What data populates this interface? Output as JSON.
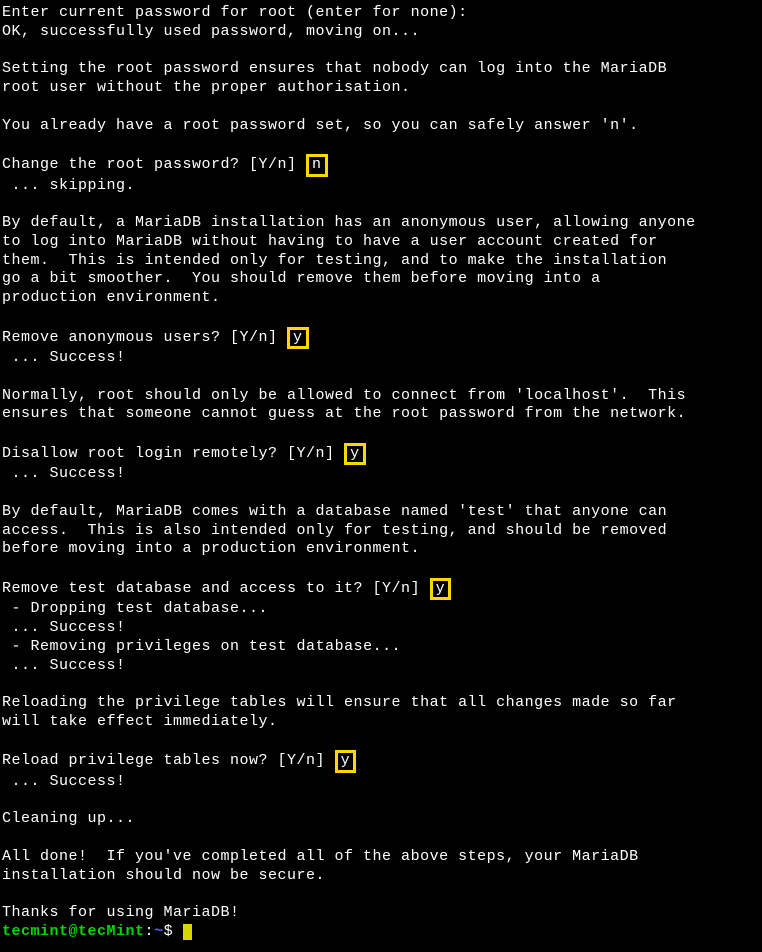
{
  "lines": {
    "l1": "Enter current password for root (enter for none):",
    "l2": "OK, successfully used password, moving on...",
    "l3": "Setting the root password ensures that nobody can log into the MariaDB",
    "l4": "root user without the proper authorisation.",
    "l5": "You already have a root password set, so you can safely answer 'n'.",
    "l6": "Change the root password? [Y/n] ",
    "l6h": "n",
    "l7": " ... skipping.",
    "l8": "By default, a MariaDB installation has an anonymous user, allowing anyone",
    "l9": "to log into MariaDB without having to have a user account created for",
    "l10": "them.  This is intended only for testing, and to make the installation",
    "l11": "go a bit smoother.  You should remove them before moving into a",
    "l12": "production environment.",
    "l13": "Remove anonymous users? [Y/n] ",
    "l13h": "y",
    "l14": " ... Success!",
    "l15": "Normally, root should only be allowed to connect from 'localhost'.  This",
    "l16": "ensures that someone cannot guess at the root password from the network.",
    "l17": "Disallow root login remotely? [Y/n] ",
    "l17h": "y",
    "l18": " ... Success!",
    "l19": "By default, MariaDB comes with a database named 'test' that anyone can",
    "l20": "access.  This is also intended only for testing, and should be removed",
    "l21": "before moving into a production environment.",
    "l22": "Remove test database and access to it? [Y/n] ",
    "l22h": "y",
    "l23": " - Dropping test database...",
    "l24": " ... Success!",
    "l25": " - Removing privileges on test database...",
    "l26": " ... Success!",
    "l27": "Reloading the privilege tables will ensure that all changes made so far",
    "l28": "will take effect immediately.",
    "l29": "Reload privilege tables now? [Y/n] ",
    "l29h": "y",
    "l30": " ... Success!",
    "l31": "Cleaning up...",
    "l32": "All done!  If you've completed all of the above steps, your MariaDB",
    "l33": "installation should now be secure.",
    "l34": "Thanks for using MariaDB!"
  },
  "prompt": {
    "user": "tecmint",
    "at": "@",
    "host": "tecMint",
    "colon": ":",
    "path": "~",
    "dollar": "$ "
  }
}
